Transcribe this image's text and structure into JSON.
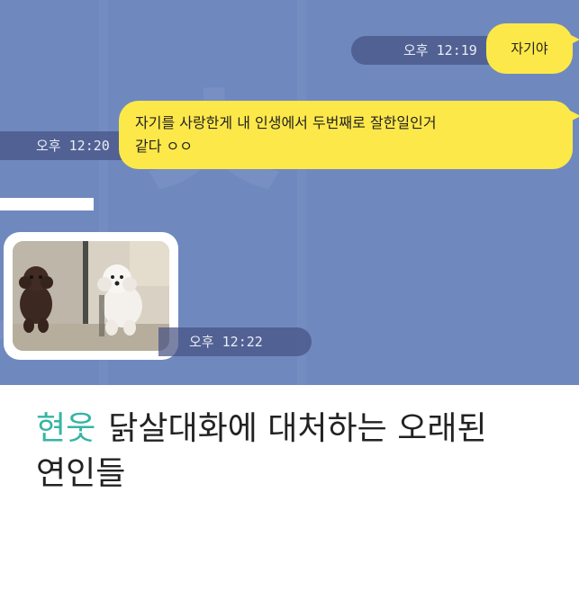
{
  "chat": {
    "background_color": "#6f89bf",
    "bubble_color": "#fde84a",
    "messages": [
      {
        "direction": "sent",
        "type": "text",
        "text": "자기야",
        "timestamp": "오후 12:19"
      },
      {
        "direction": "sent",
        "type": "text",
        "line1": "자기를 사랑한게 내 인생에서 두번째로 잘한일인거",
        "line2": "같다 ㅇㅇ",
        "timestamp": "오후 12:20"
      },
      {
        "direction": "received",
        "type": "photo",
        "image": "two-puppies-photo",
        "timestamp": "오후 12:22"
      }
    ]
  },
  "caption": {
    "author": "현웃",
    "author_color": "#35b5a3",
    "title_line1": "닭살대화에 대처하는 오래된",
    "title_line2": "연인들"
  }
}
